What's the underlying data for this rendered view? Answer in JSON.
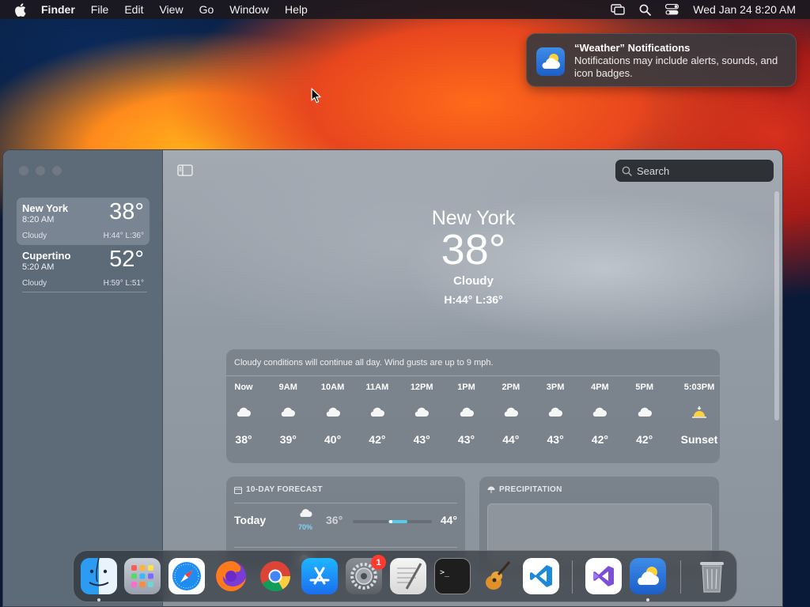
{
  "menubar": {
    "app_name": "Finder",
    "items": [
      "File",
      "Edit",
      "View",
      "Go",
      "Window",
      "Help"
    ],
    "clock": "Wed Jan 24  8:20 AM"
  },
  "notification": {
    "title": "“Weather” Notifications",
    "body": "Notifications may include alerts, sounds, and icon badges."
  },
  "sidebar": {
    "locations": [
      {
        "city": "New York",
        "time": "8:20 AM",
        "temp": "38°",
        "condition": "Cloudy",
        "hl": "H:44°  L:36°"
      },
      {
        "city": "Cupertino",
        "time": "5:20 AM",
        "temp": "52°",
        "condition": "Cloudy",
        "hl": "H:59°  L:51°"
      }
    ]
  },
  "search": {
    "placeholder": "Search"
  },
  "current": {
    "city": "New York",
    "temp": "38°",
    "condition": "Cloudy",
    "hl": "H:44°  L:36°"
  },
  "hourly": {
    "summary": "Cloudy conditions will continue all day. Wind gusts are up to 9 mph.",
    "hours": [
      {
        "label": "Now",
        "temp": "38°",
        "icon": "cloud-icon"
      },
      {
        "label": "9AM",
        "temp": "39°",
        "icon": "cloud-icon"
      },
      {
        "label": "10AM",
        "temp": "40°",
        "icon": "cloud-icon"
      },
      {
        "label": "11AM",
        "temp": "42°",
        "icon": "cloud-icon"
      },
      {
        "label": "12PM",
        "temp": "43°",
        "icon": "cloud-icon"
      },
      {
        "label": "1PM",
        "temp": "43°",
        "icon": "cloud-icon"
      },
      {
        "label": "2PM",
        "temp": "44°",
        "icon": "cloud-icon"
      },
      {
        "label": "3PM",
        "temp": "43°",
        "icon": "cloud-icon"
      },
      {
        "label": "4PM",
        "temp": "42°",
        "icon": "cloud-icon"
      },
      {
        "label": "5PM",
        "temp": "42°",
        "icon": "cloud-icon"
      },
      {
        "label": "5:03PM",
        "temp": "Sunset",
        "icon": "sunset-icon"
      }
    ]
  },
  "forecast": {
    "title": "10-DAY FORECAST",
    "days": [
      {
        "day": "Today",
        "precip": "70%",
        "low": "36°",
        "high": "44°"
      }
    ]
  },
  "precipitation": {
    "title": "PRECIPITATION"
  },
  "dock": {
    "apps": [
      "finder-icon",
      "launchpad-icon",
      "safari-icon",
      "firefox-icon",
      "chrome-icon",
      "app-store-icon",
      "system-settings-icon",
      "textedit-icon",
      "terminal-icon",
      "garageband-icon",
      "vscode-icon",
      "visual-studio-icon",
      "weather-icon",
      "trash-icon"
    ],
    "settings_badge": "1"
  }
}
